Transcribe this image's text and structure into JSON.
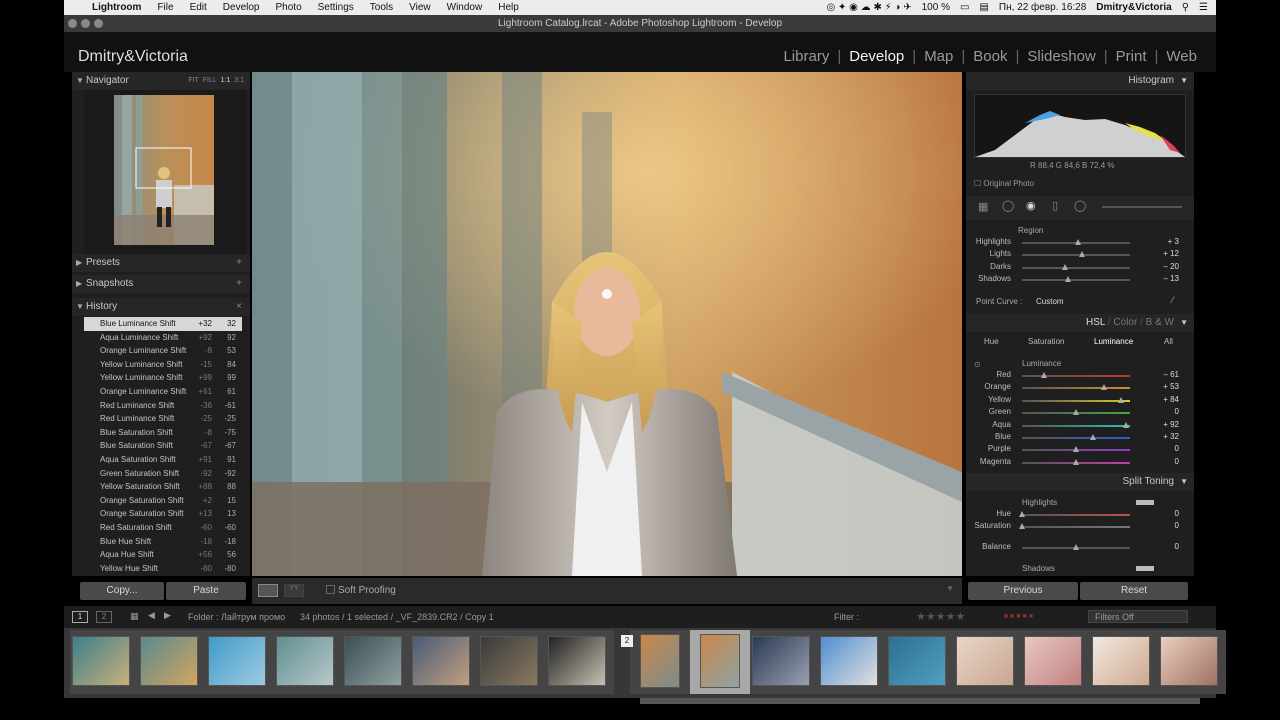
{
  "mac_menu": {
    "apple": "",
    "items": [
      "Lightroom",
      "File",
      "Edit",
      "Develop",
      "Photo",
      "Settings",
      "Tools",
      "View",
      "Window",
      "Help"
    ],
    "battery": "100 %",
    "datetime": "Пн, 22 февр.  16:28",
    "user": "Dmitry&Victoria"
  },
  "window": {
    "title": "Lightroom Catalog.lrcat - Adobe Photoshop Lightroom - Develop"
  },
  "identity": "Dmitry&Victoria",
  "modules": [
    "Library",
    "Develop",
    "Map",
    "Book",
    "Slideshow",
    "Print",
    "Web"
  ],
  "active_module": "Develop",
  "left": {
    "navigator": {
      "label": "Navigator",
      "opts": [
        "FIT",
        "FILL",
        "1:1",
        "3:1"
      ]
    },
    "presets": "Presets",
    "snapshots": "Snapshots",
    "history": {
      "label": "History",
      "rows": [
        [
          "Blue Luminance Shift",
          "+32",
          "32"
        ],
        [
          "Aqua Luminance Shift",
          "+92",
          "92"
        ],
        [
          "Orange Luminance Shift",
          "-8",
          "53"
        ],
        [
          "Yellow Luminance Shift",
          "-15",
          "84"
        ],
        [
          "Yellow Luminance Shift",
          "+99",
          "99"
        ],
        [
          "Orange Luminance Shift",
          "+61",
          "61"
        ],
        [
          "Red Luminance Shift",
          "-36",
          "-61"
        ],
        [
          "Red Luminance Shift",
          "-25",
          "-25"
        ],
        [
          "Blue Saturation Shift",
          "-8",
          "-75"
        ],
        [
          "Blue Saturation Shift",
          "-67",
          "-67"
        ],
        [
          "Aqua Saturation Shift",
          "+91",
          "91"
        ],
        [
          "Green Saturation Shift",
          "-92",
          "-92"
        ],
        [
          "Yellow Saturation Shift",
          "+88",
          "88"
        ],
        [
          "Orange Saturation Shift",
          "+2",
          "15"
        ],
        [
          "Orange Saturation Shift",
          "+13",
          "13"
        ],
        [
          "Red Saturation Shift",
          "-60",
          "-60"
        ],
        [
          "Blue Hue Shift",
          "-18",
          "-18"
        ],
        [
          "Aqua Hue Shift",
          "+56",
          "56"
        ],
        [
          "Yellow Hue Shift",
          "-80",
          "-80"
        ]
      ]
    },
    "copy_btn": "Copy...",
    "paste_btn": "Paste"
  },
  "right": {
    "histogram_label": "Histogram",
    "rgb": "R  88,4  G  84,6  B  72,4 %",
    "original_photo": "Original Photo",
    "region_label": "Region",
    "curve": [
      {
        "name": "Highlights",
        "value": "+ 3",
        "pos": 0.52
      },
      {
        "name": "Lights",
        "value": "+ 12",
        "pos": 0.56
      },
      {
        "name": "Darks",
        "value": "– 20",
        "pos": 0.4
      },
      {
        "name": "Shadows",
        "value": "– 13",
        "pos": 0.43
      }
    ],
    "point_curve_label": "Point Curve :",
    "point_curve_value": "Custom",
    "hsl_header": [
      "HSL",
      "Color",
      "B & W"
    ],
    "hsl_tabs": [
      "Hue",
      "Saturation",
      "Luminance",
      "All"
    ],
    "hsl_active": "Luminance",
    "luminance_label": "Luminance",
    "lum": [
      {
        "name": "Red",
        "value": "– 61",
        "pos": 0.2,
        "color": "#c0392b"
      },
      {
        "name": "Orange",
        "value": "+ 53",
        "pos": 0.76,
        "color": "#d98a2b"
      },
      {
        "name": "Yellow",
        "value": "+ 84",
        "pos": 0.92,
        "color": "#d9c92b"
      },
      {
        "name": "Green",
        "value": "0",
        "pos": 0.5,
        "color": "#3fa84a"
      },
      {
        "name": "Aqua",
        "value": "+ 92",
        "pos": 0.96,
        "color": "#2bc0b5"
      },
      {
        "name": "Blue",
        "value": "+ 32",
        "pos": 0.66,
        "color": "#2b5fc0"
      },
      {
        "name": "Purple",
        "value": "0",
        "pos": 0.5,
        "color": "#8b3fc0"
      },
      {
        "name": "Magenta",
        "value": "0",
        "pos": 0.5,
        "color": "#c03fa8"
      }
    ],
    "split_toning": "Split Toning",
    "st_highlights": "Highlights",
    "st_rows": [
      {
        "name": "Hue",
        "value": "0",
        "pos": 0.0
      },
      {
        "name": "Saturation",
        "value": "0",
        "pos": 0.0
      }
    ],
    "balance": {
      "name": "Balance",
      "value": "0",
      "pos": 0.5
    },
    "st_shadows": "Shadows",
    "previous_btn": "Previous",
    "reset_btn": "Reset"
  },
  "toolbar": {
    "soft_proofing": "Soft Proofing"
  },
  "filmbar": {
    "folder": "Folder : Лайтрум промо",
    "info": "34 photos / 1 selected / _VF_2839.CR2 / Copy 1",
    "filter_label": "Filter :",
    "filter_value": "Filters Off",
    "page1": "1",
    "page2": "2"
  },
  "filmstrip": {
    "badge": "2"
  }
}
